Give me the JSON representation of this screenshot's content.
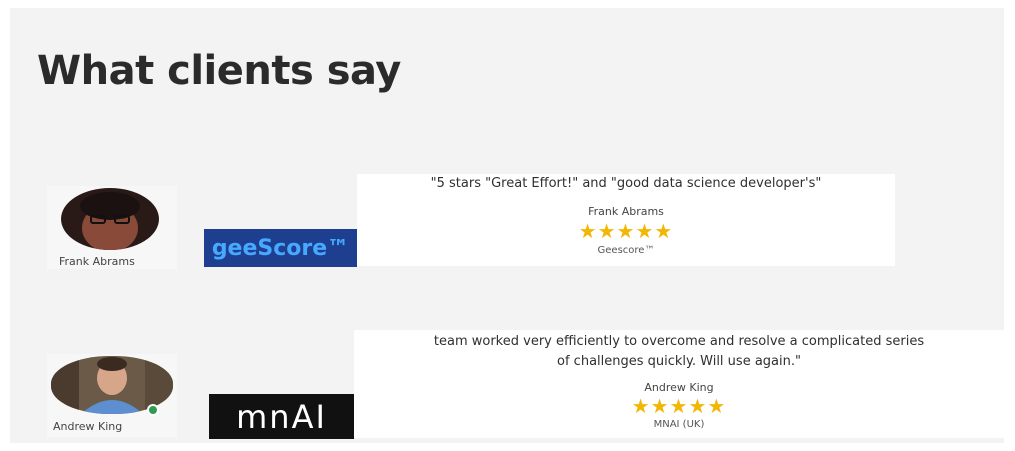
{
  "section": {
    "title": "What clients say"
  },
  "testimonials": [
    {
      "avatar_name": "Frank Abrams",
      "logo_text": "geeScore™",
      "quote_lines": [
        "\"5 stars \"Great Effort!\" and \"good data science developer's\""
      ],
      "reviewer": "Frank Abrams",
      "stars": "★★★★★",
      "rating": 5,
      "company": "Geescore™"
    },
    {
      "avatar_name": "Andrew King",
      "logo_text": "mnAI",
      "quote_lines": [
        "team worked very efficiently to overcome and resolve a complicated series",
        "of challenges quickly. Will use again.\""
      ],
      "reviewer": "Andrew King",
      "stars": "★★★★★",
      "rating": 5,
      "company": "MNAI (UK)"
    }
  ],
  "colors": {
    "star": "#f2b705",
    "geescore_bg": "#1e3f8f",
    "geescore_accent": "#47a8ff",
    "mnai_bg": "#111111"
  }
}
